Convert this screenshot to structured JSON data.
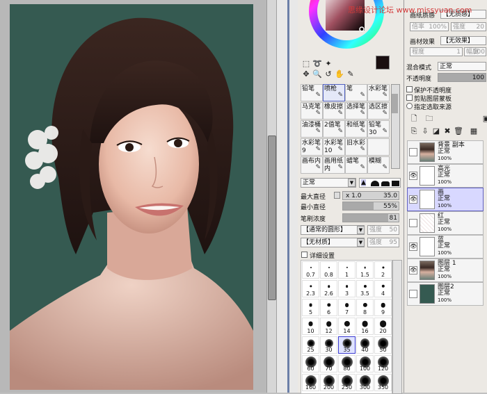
{
  "watermark": "思缘设计论坛 www.missyuan.com",
  "tools_panel": {
    "brushes": [
      {
        "label": "铅笔",
        "icon": "pencil-icon"
      },
      {
        "label": "喷枪",
        "icon": "airbrush-icon",
        "selected": true
      },
      {
        "label": "笔",
        "icon": "pen-icon"
      },
      {
        "label": "水彩笔",
        "icon": "watercolor-icon"
      },
      {
        "label": "马克笔",
        "icon": "marker-icon"
      },
      {
        "label": "橡皮擦",
        "icon": "eraser-icon"
      },
      {
        "label": "选择笔",
        "icon": "select-pen-icon"
      },
      {
        "label": "选区擦",
        "icon": "select-eraser-icon"
      },
      {
        "label": "油漆桶",
        "icon": "bucket-icon"
      },
      {
        "label": "2值笔",
        "icon": "binary-pen-icon"
      },
      {
        "label": "和纸笔",
        "icon": "washi-pen-icon"
      },
      {
        "label": "铅笔30",
        "icon": "pencil30-icon"
      },
      {
        "label": "水彩笔9",
        "icon": "watercolor9-icon"
      },
      {
        "label": "水彩笔10",
        "icon": "watercolor10-icon"
      },
      {
        "label": "旧水彩",
        "icon": "old-watercolor-icon"
      },
      {
        "label": "",
        "icon": ""
      },
      {
        "label": "画布内",
        "icon": "canvas-icon"
      },
      {
        "label": "画用纸内",
        "icon": "drawing-paper-icon"
      },
      {
        "label": "蜡笔",
        "icon": "crayon-icon"
      },
      {
        "label": "模糊",
        "icon": "blur-icon"
      }
    ],
    "blend_mode": "正常",
    "max_diameter_label": "最大直径",
    "max_diameter_multiplier": "x 1.0",
    "max_diameter_value": "35.0",
    "min_diameter_label": "最小直径",
    "min_diameter_value": "55%",
    "min_diameter_fill": 0.55,
    "density_label": "笔刷浓度",
    "density_value": "81",
    "density_fill": 0.81,
    "shape_select": "【通常的圆形】",
    "texture_select": "【无材质】",
    "strength_label": "强度",
    "strength_values": [
      "50",
      "95"
    ],
    "detail_settings": "详细设置",
    "sizes": [
      "0.7",
      "0.8",
      "1",
      "1.5",
      "2",
      "2.3",
      "2.6",
      "3",
      "3.5",
      "4",
      "5",
      "6",
      "7",
      "8",
      "9",
      "10",
      "12",
      "14",
      "16",
      "20",
      "25",
      "30",
      "35",
      "40",
      "50",
      "60",
      "70",
      "80",
      "100",
      "120",
      "160",
      "200",
      "250",
      "300",
      "350"
    ],
    "selected_size": "35"
  },
  "layer_panel": {
    "paper_quality_label": "画纸质感",
    "paper_quality_value": "【无质感】",
    "magnification_label": "倍率",
    "magnification_value": "100%",
    "strength_label": "强度",
    "strength_value": "20",
    "brush_effect_label": "画材效果",
    "brush_effect_value": "【无效果】",
    "degree_label": "程度",
    "degree_value": "1",
    "width_label": "幅度",
    "width_value": "100",
    "mix_mode_label": "混合模式",
    "mix_mode_value": "正常",
    "opacity_label": "不透明度",
    "opacity_value": "100",
    "options": [
      "保护不透明度",
      "剪贴图层蒙板",
      "指定选取来源"
    ],
    "layers": [
      {
        "name": "背景 副本",
        "mode": "正常",
        "opacity": "100%",
        "visible": false,
        "thumb": "portrait",
        "selected": false
      },
      {
        "name": "高光",
        "mode": "正常",
        "opacity": "100%",
        "visible": true,
        "thumb": "blank",
        "selected": false
      },
      {
        "name": "画",
        "mode": "正常",
        "opacity": "100%",
        "visible": true,
        "thumb": "blank",
        "selected": true
      },
      {
        "name": "红",
        "mode": "正常",
        "opacity": "100%",
        "visible": false,
        "thumb": "sketch",
        "selected": false
      },
      {
        "name": "蓝",
        "mode": "正常",
        "opacity": "100%",
        "visible": true,
        "thumb": "blank",
        "selected": false
      },
      {
        "name": "图层 1",
        "mode": "正常",
        "opacity": "100%",
        "visible": true,
        "thumb": "portrait",
        "selected": false
      },
      {
        "name": "图层2",
        "mode": "正常",
        "opacity": "100%",
        "visible": false,
        "thumb": "teal",
        "selected": false
      }
    ]
  },
  "colors": {
    "painting_bg": "#355a51",
    "selection_blue": "#5060c0",
    "main_color": "#1a0f10",
    "sub_color": "#ffffff"
  }
}
